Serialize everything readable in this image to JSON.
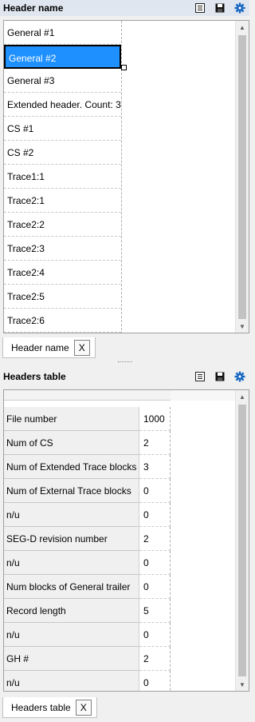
{
  "header_panel": {
    "title": "Header name",
    "items": [
      {
        "label": "General #1"
      },
      {
        "label": "General #2",
        "selected": true
      },
      {
        "label": "General #3"
      },
      {
        "label": "Extended header. Count: 3"
      },
      {
        "label": "CS #1"
      },
      {
        "label": "CS #2"
      },
      {
        "label": "Trace1:1"
      },
      {
        "label": "Trace2:1"
      },
      {
        "label": "Trace2:2"
      },
      {
        "label": "Trace2:3"
      },
      {
        "label": "Trace2:4"
      },
      {
        "label": "Trace2:5"
      },
      {
        "label": "Trace2:6"
      }
    ],
    "tab_label": "Header name",
    "tab_close": "X",
    "icons": [
      "list-icon",
      "save-icon",
      "gear-icon"
    ]
  },
  "table_panel": {
    "title": "Headers table",
    "rows": [
      {
        "name": "File number",
        "value": "1000"
      },
      {
        "name": "Num of CS",
        "value": "2"
      },
      {
        "name": "Num of Extended Trace blocks",
        "value": "3"
      },
      {
        "name": "Num of External Trace blocks",
        "value": "0"
      },
      {
        "name": "n/u",
        "value": "0"
      },
      {
        "name": "SEG-D revision number",
        "value": "2"
      },
      {
        "name": "n/u",
        "value": "0"
      },
      {
        "name": "Num blocks of General trailer",
        "value": "0"
      },
      {
        "name": "Record length",
        "value": "5"
      },
      {
        "name": "n/u",
        "value": "0"
      },
      {
        "name": "GH #",
        "value": "2"
      },
      {
        "name": "n/u",
        "value": "0"
      }
    ],
    "tab_label": "Headers table",
    "tab_close": "X",
    "icons": [
      "list-icon",
      "save-icon",
      "gear-icon"
    ]
  },
  "colors": {
    "selection": "#1e90ff",
    "header_bg": "#dfe6ef",
    "gear": "#1565c0"
  }
}
